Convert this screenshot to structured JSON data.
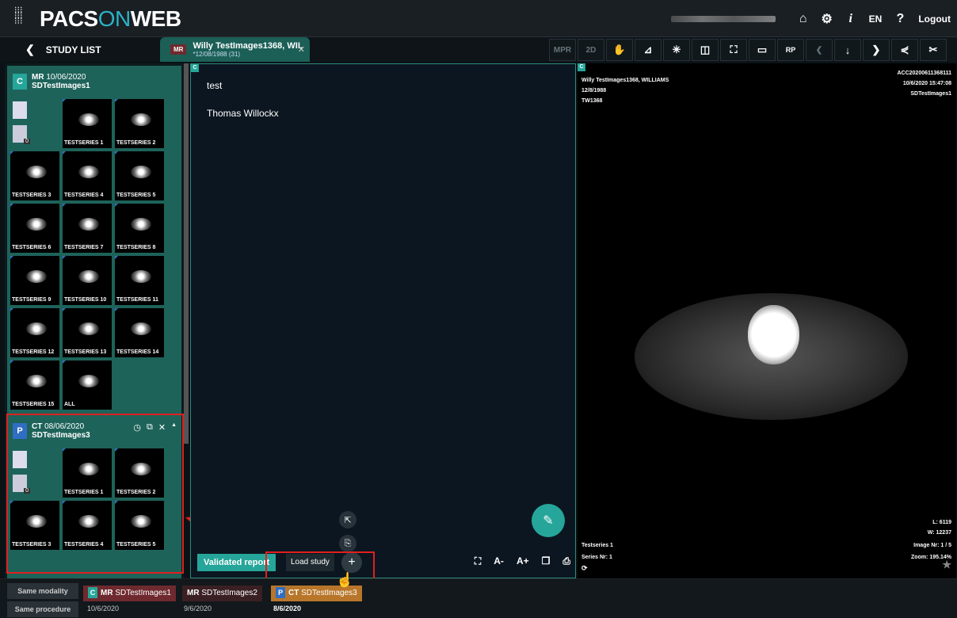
{
  "topbar": {
    "logo_text_a": "PACS",
    "logo_text_b": "ON",
    "logo_text_c": "WEB",
    "language": "EN",
    "help": "?",
    "logout": "Logout"
  },
  "tabs": {
    "study_list": "STUDY LIST",
    "patient_badge": "MR",
    "patient_name": "Willy TestImages1368, WIL",
    "patient_sub": "*12/08/1988 (31)"
  },
  "toolbar": [
    "MPR",
    "2D",
    "RP"
  ],
  "left_studies": [
    {
      "badge": "C",
      "modality": "MR",
      "date": "10/06/2020",
      "description": "SDTestImages1",
      "doc_count": "0",
      "series": [
        "TESTSERIES 1",
        "TESTSERIES 2",
        "TESTSERIES 3",
        "TESTSERIES 4",
        "TESTSERIES 5",
        "TESTSERIES 6",
        "TESTSERIES 7",
        "TESTSERIES 8",
        "TESTSERIES 9",
        "TESTSERIES 10",
        "TESTSERIES 11",
        "TESTSERIES 12",
        "TESTSERIES 13",
        "TESTSERIES 14",
        "TESTSERIES 15",
        "ALL"
      ]
    },
    {
      "badge": "P",
      "modality": "CT",
      "date": "08/06/2020",
      "description": "SDTestImages3",
      "doc_count": "0",
      "series": [
        "TESTSERIES 1",
        "TESTSERIES 2",
        "TESTSERIES 3",
        "TESTSERIES 4",
        "TESTSERIES 5"
      ]
    }
  ],
  "report": {
    "corner": "C",
    "line1": "test",
    "line2": "Thomas Willockx",
    "validated": "Validated report",
    "load_study": "Load study",
    "plus": "+",
    "font_minus": "A-",
    "font_plus": "A+"
  },
  "viewer": {
    "corner": "C",
    "patient": "Willy TestImages1368, WILLIAMS",
    "dob": "12/8/1988",
    "pid": "TW1368",
    "accession": "ACC20200611368111",
    "datetime": "10/6/2020 15:47:08",
    "study": "SDTestImages1",
    "level": "L: 6119",
    "width": "W: 12237",
    "image_nr": "Image Nr: 1 / 5",
    "zoom": "Zoom: 195.14%",
    "series_name": "Testseries 1",
    "series_nr": "Series Nr: 1"
  },
  "bottom": {
    "same_modality": "Same modality",
    "same_procedure": "Same procedure",
    "tabs": [
      {
        "badge": "C",
        "mod": "MR",
        "name": "SDTestImages1",
        "date": "10/6/2020"
      },
      {
        "badge": "",
        "mod": "MR",
        "name": "SDTestImages2",
        "date": "9/6/2020"
      },
      {
        "badge": "P",
        "mod": "CT",
        "name": "SDTestImages3",
        "date": "8/6/2020"
      }
    ]
  },
  "colors": {
    "accent": "#26a69a",
    "highlight": "#e0201f",
    "logo_on": "#2ab3c6"
  }
}
